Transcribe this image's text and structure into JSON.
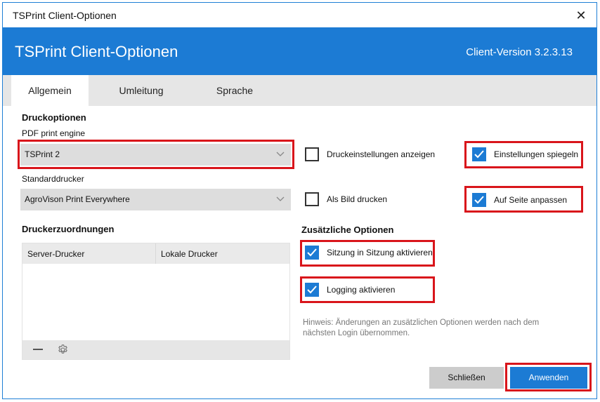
{
  "window": {
    "title": "TSPrint Client-Optionen",
    "close_glyph": "✕"
  },
  "banner": {
    "app_title": "TSPrint Client-Optionen",
    "version": "Client-Version 3.2.3.13",
    "color": "#1c7bd4"
  },
  "tabs": [
    {
      "label": "Allgemein",
      "active": true
    },
    {
      "label": "Umleitung",
      "active": false
    },
    {
      "label": "Sprache",
      "active": false
    }
  ],
  "print_options": {
    "heading": "Druckoptionen",
    "pdf_engine_label": "PDF print engine",
    "pdf_engine_value": "TSPrint 2",
    "default_printer_label": "Standarddrucker",
    "default_printer_value": "AgroVison Print Everywhere"
  },
  "printer_mapping": {
    "heading": "Druckerzuordnungen",
    "columns": [
      "Server-Drucker",
      "Lokale Drucker"
    ],
    "rows": [],
    "remove_icon": "minus-icon",
    "settings_icon": "gear-icon"
  },
  "checkboxes": {
    "show_print_settings": {
      "label": "Druckeinstellungen anzeigen",
      "checked": false
    },
    "mirror_settings": {
      "label": "Einstellungen spiegeln",
      "checked": true
    },
    "print_as_image": {
      "label": "Als Bild drucken",
      "checked": false
    },
    "fit_to_page": {
      "label": "Auf Seite anpassen",
      "checked": true
    }
  },
  "additional_options": {
    "heading": "Zusätzliche Optionen",
    "session_in_session": {
      "label": "Sitzung in Sitzung aktivieren",
      "checked": true
    },
    "logging": {
      "label": "Logging aktivieren",
      "checked": true
    },
    "hint": "Hinweis: Änderungen an zusätzlichen Optionen werden nach dem nächsten Login übernommen."
  },
  "buttons": {
    "close": "Schließen",
    "apply": "Anwenden"
  },
  "colors": {
    "accent": "#1c7bd4",
    "highlight": "#d9151b"
  }
}
